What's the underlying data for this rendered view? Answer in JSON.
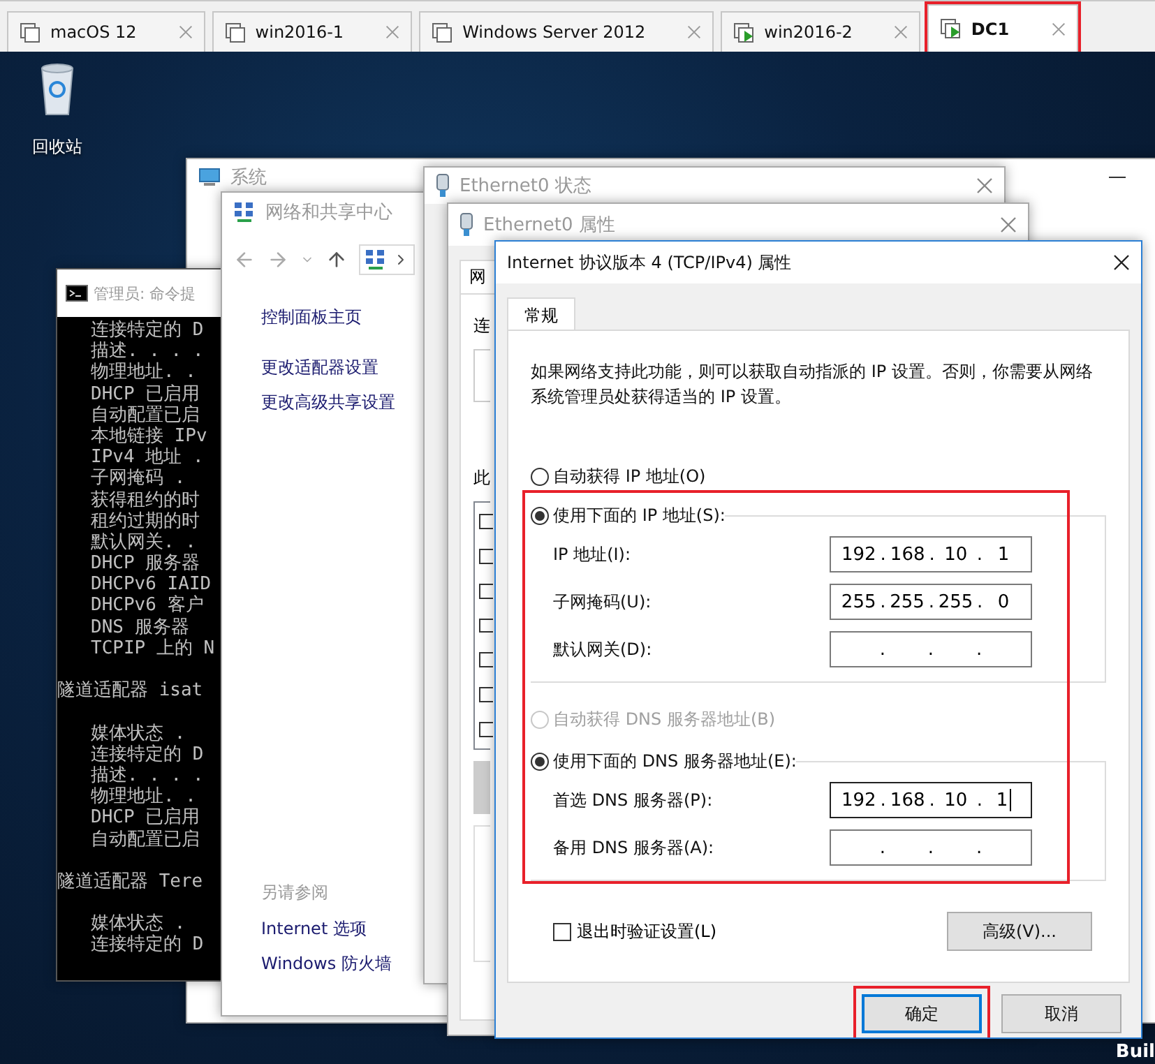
{
  "vm_tabs": [
    {
      "label": "macOS 12",
      "running": false,
      "selected": false,
      "highlighted": false
    },
    {
      "label": "win2016-1",
      "running": false,
      "selected": false,
      "highlighted": false
    },
    {
      "label": "Windows Server 2012",
      "running": false,
      "selected": false,
      "highlighted": false
    },
    {
      "label": "win2016-2",
      "running": true,
      "selected": false,
      "highlighted": false
    },
    {
      "label": "DC1",
      "running": true,
      "selected": true,
      "highlighted": true
    }
  ],
  "desktop": {
    "icons": [
      {
        "label": "回收站"
      }
    ],
    "corner_text": "Buil"
  },
  "system_window": {
    "title": "系统"
  },
  "cmd_window": {
    "title": "管理员: 命令提",
    "sections": [
      {
        "lines": [
          "连接特定的 D",
          "描述. . . .",
          "物理地址. .",
          "DHCP 已启用",
          "自动配置已启",
          "本地链接 IPv",
          "IPv4 地址 .",
          "子网掩码 .",
          "获得租约的时",
          "租约过期的时",
          "默认网关. .",
          "DHCP 服务器",
          "DHCPv6 IAID",
          "DHCPv6 客户",
          "DNS 服务器",
          "TCPIP 上的 N"
        ]
      },
      {
        "title": "隧道适配器 isat",
        "lines": [
          "媒体状态 .",
          "连接特定的 D",
          "描述. . . .",
          "物理地址. .",
          "DHCP 已启用",
          "自动配置已启"
        ]
      },
      {
        "title": "隧道适配器 Tere",
        "lines": [
          "媒体状态 .",
          "连接特定的 D"
        ]
      }
    ]
  },
  "network_window": {
    "title": "网络和共享中心",
    "links": [
      "控制面板主页",
      "更改适配器设置",
      "更改高级共享设置"
    ],
    "see_also": {
      "title": "另请参阅",
      "links": [
        "Internet 选项",
        "Windows 防火墙"
      ]
    }
  },
  "status_window": {
    "title": "Ethernet0 状态"
  },
  "properties_window": {
    "title": "Ethernet0 属性",
    "tab": "网",
    "labels": [
      "连",
      "此"
    ]
  },
  "ipv4_dialog": {
    "title": "Internet 协议版本 4 (TCP/IPv4) 属性",
    "tabs": [
      {
        "label": "常规",
        "selected": true
      }
    ],
    "description": "如果网络支持此功能，则可以获取自动指派的 IP 设置。否则，你需要从网络系统管理员处获得适当的 IP 设置。",
    "separator": ".",
    "highlight_settings": true,
    "ip_options": [
      {
        "label": "自动获得 IP 地址(O)",
        "selected": false,
        "disabled": false
      },
      {
        "label": "使用下面的 IP 地址(S):",
        "selected": true,
        "disabled": false
      }
    ],
    "ip_fields": [
      {
        "label": "IP 地址(I):",
        "octets": [
          "192",
          "168",
          "10",
          "1"
        ],
        "focused": false
      },
      {
        "label": "子网掩码(U):",
        "octets": [
          "255",
          "255",
          "255",
          "0"
        ],
        "focused": false
      },
      {
        "label": "默认网关(D):",
        "focused": false
      }
    ],
    "dns_options": [
      {
        "label": "自动获得 DNS 服务器地址(B)",
        "selected": false,
        "disabled": true
      },
      {
        "label": "使用下面的 DNS 服务器地址(E):",
        "selected": true,
        "disabled": false
      }
    ],
    "dns_fields": [
      {
        "label": "首选 DNS 服务器(P):",
        "octets": [
          "192",
          "168",
          "10",
          "1"
        ],
        "focused": true
      },
      {
        "label": "备用 DNS 服务器(A):",
        "focused": false
      }
    ],
    "validate": {
      "label": "退出时验证设置(L)",
      "checked": false
    },
    "advanced_button": "高级(V)...",
    "buttons": [
      {
        "label": "确定",
        "default": true,
        "highlighted": true
      },
      {
        "label": "取消",
        "default": false,
        "highlighted": false
      }
    ]
  }
}
